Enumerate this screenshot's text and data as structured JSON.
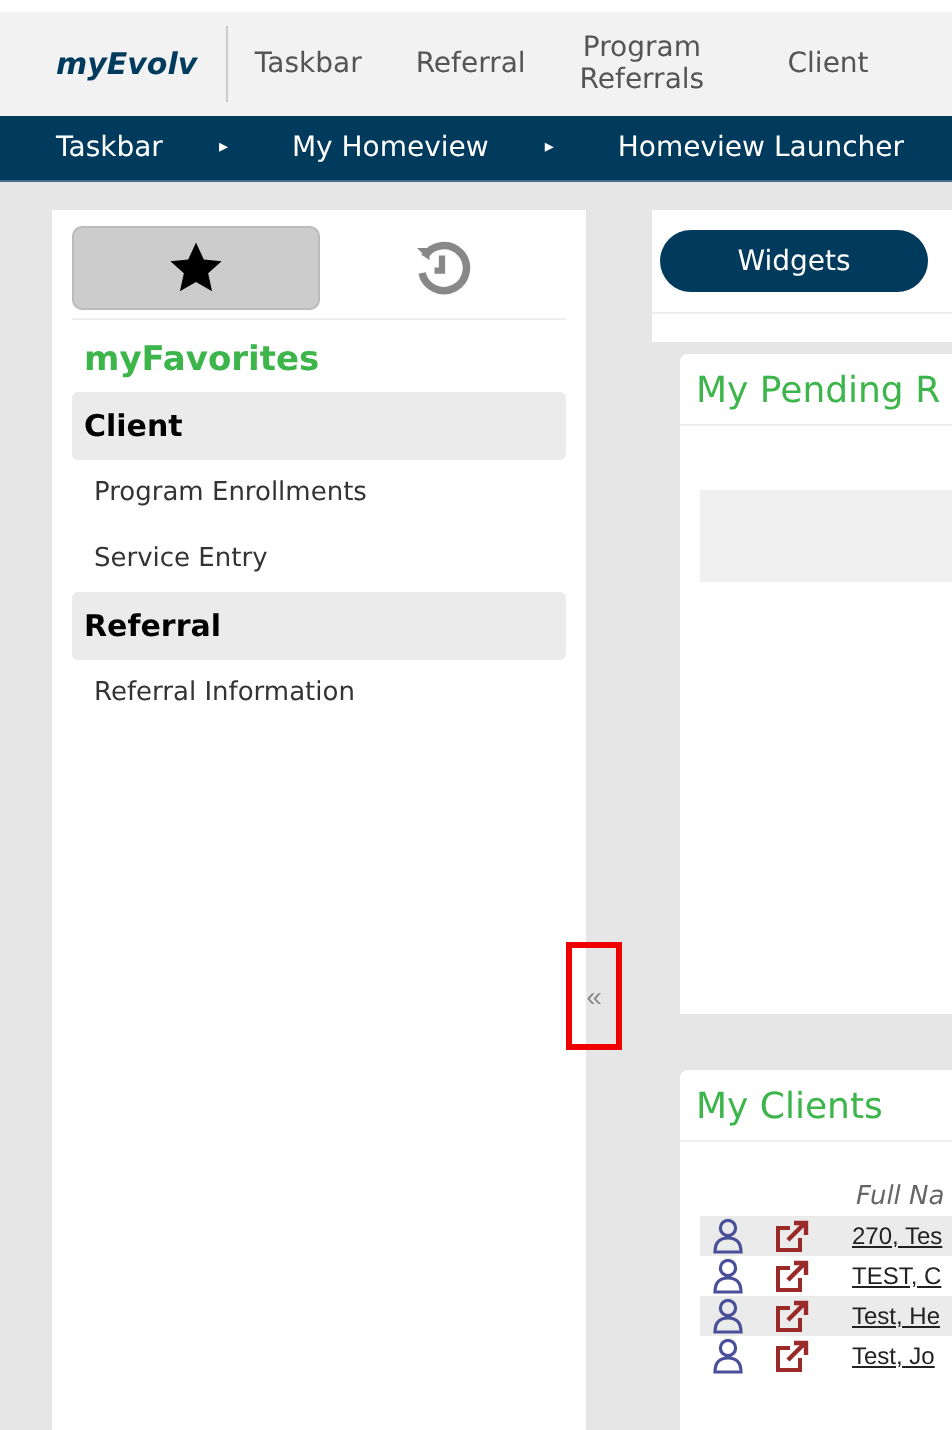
{
  "app_name": "myEvolv",
  "nav": [
    {
      "label": "Taskbar"
    },
    {
      "label": "Referral"
    },
    {
      "label": "Program Referrals"
    },
    {
      "label": "Client"
    }
  ],
  "breadcrumb": [
    {
      "label": "Taskbar"
    },
    {
      "label": "My Homeview"
    },
    {
      "label": "Homeview Launcher"
    }
  ],
  "breadcrumb_separator": "▸",
  "sidebar": {
    "tabs": [
      {
        "kind": "star",
        "selected": true
      },
      {
        "kind": "history",
        "selected": false
      }
    ],
    "title": "myFavorites",
    "groups": [
      {
        "label": "Client",
        "items": [
          {
            "label": "Program Enrollments"
          },
          {
            "label": "Service Entry"
          }
        ]
      },
      {
        "label": "Referral",
        "items": [
          {
            "label": "Referral Information"
          }
        ]
      }
    ]
  },
  "collapse_button": "«",
  "widgets_button": "Widgets",
  "pending_card": {
    "title": "My Pending R"
  },
  "clients_card": {
    "title": "My Clients",
    "column_3": "Full Na",
    "rows": [
      {
        "name": "270, Tes"
      },
      {
        "name": "TEST, C"
      },
      {
        "name": "Test, He"
      },
      {
        "name": "Test, Jo"
      }
    ]
  }
}
